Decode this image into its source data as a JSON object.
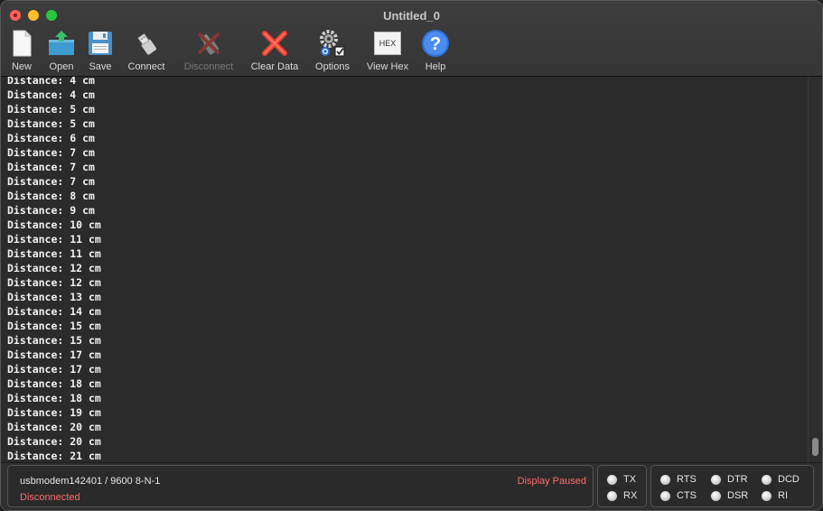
{
  "window": {
    "title": "Untitled_0",
    "traffic_lights": [
      {
        "name": "close",
        "color": "#ff5f57"
      },
      {
        "name": "minimize",
        "color": "#febc2e"
      },
      {
        "name": "maximize",
        "color": "#28c840"
      }
    ]
  },
  "toolbar": {
    "new_label": "New",
    "open_label": "Open",
    "save_label": "Save",
    "connect_label": "Connect",
    "disconnect_label": "Disconnect",
    "clear_label": "Clear Data",
    "options_label": "Options",
    "hex_label": "View Hex",
    "hex_icon_text": "HEX",
    "help_label": "Help",
    "disconnect_enabled": false
  },
  "console": {
    "lines": [
      "Distance: 4 cm",
      "Distance: 4 cm",
      "Distance: 5 cm",
      "Distance: 5 cm",
      "Distance: 6 cm",
      "Distance: 7 cm",
      "Distance: 7 cm",
      "Distance: 7 cm",
      "Distance: 8 cm",
      "Distance: 9 cm",
      "Distance: 10 cm",
      "Distance: 11 cm",
      "Distance: 11 cm",
      "Distance: 12 cm",
      "Distance: 12 cm",
      "Distance: 13 cm",
      "Distance: 14 cm",
      "Distance: 15 cm",
      "Distance: 15 cm",
      "Distance: 17 cm",
      "Distance: 17 cm",
      "Distance: 18 cm",
      "Distance: 18 cm",
      "Distance: 19 cm",
      "Distance: 20 cm",
      "Distance: 20 cm",
      "Distance: 21 cm"
    ]
  },
  "status": {
    "port": "usbmodem142401 / 9600 8-N-1",
    "connection": "Disconnected",
    "display_state": "Display Paused",
    "status_color": "#ff6b6b",
    "indicators": {
      "tx": "TX",
      "rx": "RX",
      "rts": "RTS",
      "cts": "CTS",
      "dtr": "DTR",
      "dsr": "DSR",
      "dcd": "DCD",
      "ri": "RI"
    }
  }
}
